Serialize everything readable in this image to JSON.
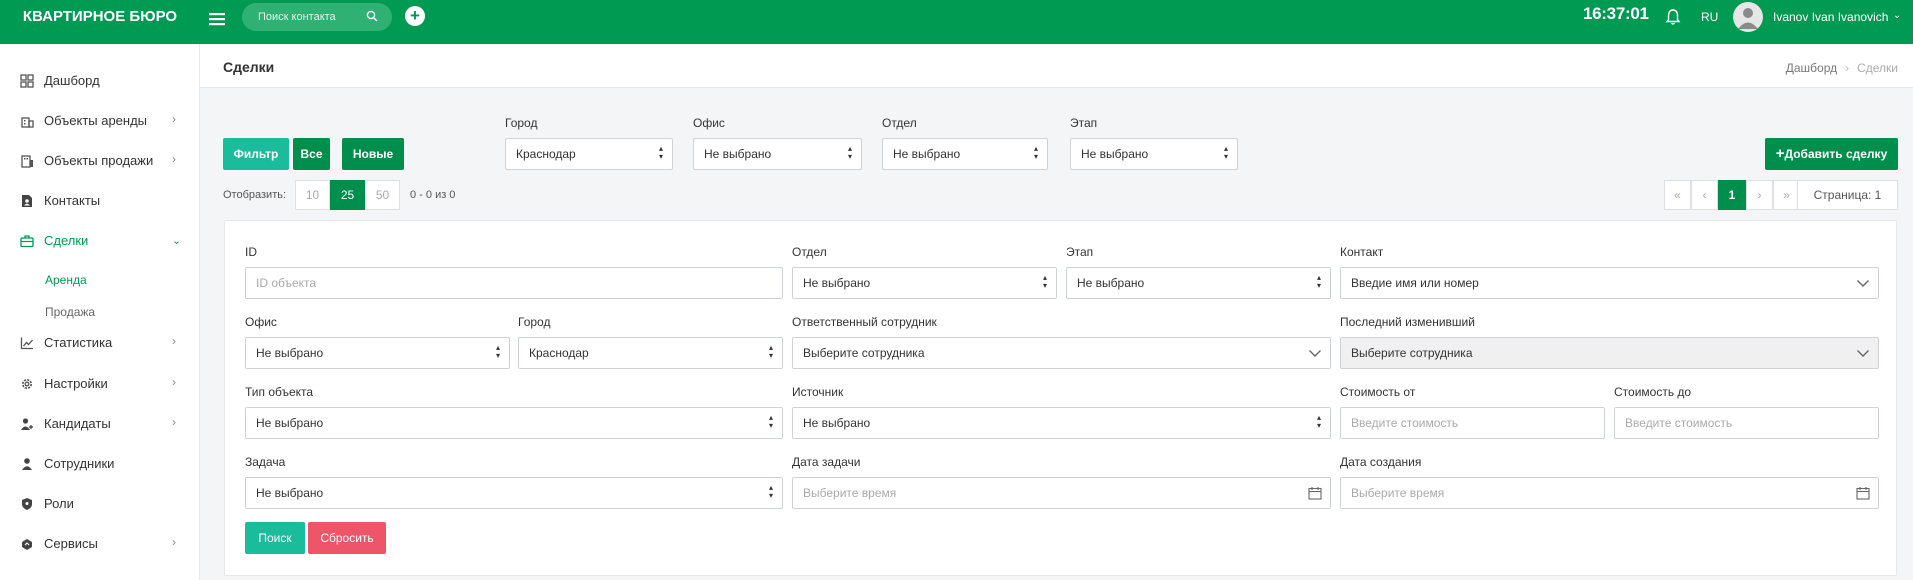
{
  "topbar": {
    "brand": "КВАРТИРНОЕ БЮРО",
    "search_placeholder": "Поиск контакта",
    "clock": "16:37:01",
    "lang": "RU",
    "user_name": "Ivanov Ivan Ivanovich",
    "accent": "#009a53"
  },
  "sidebar": {
    "items": [
      {
        "label": "Дашборд",
        "icon": "dashboard-icon"
      },
      {
        "label": "Объекты аренды",
        "icon": "building-icon"
      },
      {
        "label": "Объекты продажи",
        "icon": "building-sale-icon"
      },
      {
        "label": "Контакты",
        "icon": "contact-card-icon"
      },
      {
        "label": "Сделки",
        "icon": "briefcase-icon"
      },
      {
        "label": "Статистика",
        "icon": "chart-icon"
      },
      {
        "label": "Настройки",
        "icon": "gear-icon"
      },
      {
        "label": "Кандидаты",
        "icon": "candidates-icon"
      },
      {
        "label": "Сотрудники",
        "icon": "user-icon"
      },
      {
        "label": "Роли",
        "icon": "shield-icon"
      },
      {
        "label": "Сервисы",
        "icon": "services-icon"
      }
    ],
    "subitems": [
      {
        "label": "Аренда"
      },
      {
        "label": "Продажа"
      }
    ]
  },
  "header": {
    "title": "Сделки",
    "breadcrumb": [
      "Дашборд",
      "Сделки"
    ]
  },
  "toolbar": {
    "filter_label": "Фильтр",
    "all_label": "Все",
    "new_label": "Новые",
    "city_label": "Город",
    "city_value": "Краснодар",
    "office_label": "Офис",
    "office_value": "Не выбрано",
    "dept_label": "Отдел",
    "dept_value": "Не выбрано",
    "stage_label": "Этап",
    "stage_value": "Не выбрано",
    "add_label": "Добавить сделку"
  },
  "paging": {
    "show_label": "Отобразить:",
    "sizes": [
      "10",
      "25",
      "50"
    ],
    "active_size": "25",
    "count": "0 - 0 из 0",
    "first": "«",
    "prev": "‹",
    "current": "1",
    "next": "›",
    "last": "»",
    "page_info": "Страница: 1"
  },
  "filters": {
    "id_label": "ID",
    "id_placeholder": "ID объекта",
    "dept_label": "Отдел",
    "dept_value": "Не выбрано",
    "stage_label": "Этап",
    "stage_value": "Не выбрано",
    "contact_label": "Контакт",
    "contact_value": "Введие имя или номер",
    "office_label": "Офис",
    "office_value": "Не выбрано",
    "city_label": "Город",
    "city_value": "Краснодар",
    "resp_label": "Ответственный сотрудник",
    "resp_value": "Выберите сотрудника",
    "lastmod_label": "Последний изменивший",
    "lastmod_value": "Выберите сотрудника",
    "objtype_label": "Тип объекта",
    "objtype_value": "Не выбрано",
    "source_label": "Источник",
    "source_value": "Не выбрано",
    "price_from_label": "Стоимость от",
    "price_from_placeholder": "Введите стоимость",
    "price_to_label": "Стоимость до",
    "price_to_placeholder": "Введите стоимость",
    "task_label": "Задача",
    "task_value": "Не выбрано",
    "task_date_label": "Дата задачи",
    "task_date_placeholder": "Выберите время",
    "created_label": "Дата создания",
    "created_placeholder": "Выберите время",
    "search_button": "Поиск",
    "reset_button": "Сбросить"
  },
  "colors": {
    "accent": "#009a53",
    "filter_teal": "#1bbc9b",
    "danger": "#ef5569"
  }
}
